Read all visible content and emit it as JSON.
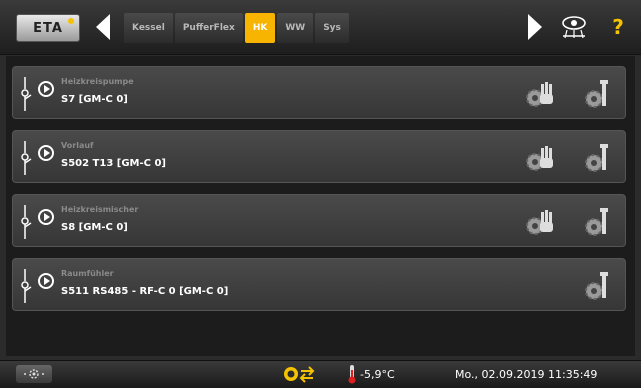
{
  "header": {
    "logo_text": "ETA",
    "tabs": [
      {
        "label": "Kessel",
        "active": false
      },
      {
        "label": "PufferFlex",
        "active": false
      },
      {
        "label": "HK",
        "active": true
      },
      {
        "label": "WW",
        "active": false
      },
      {
        "label": "Sys",
        "active": false
      }
    ],
    "help_label": "?",
    "accent_color": "#f7b400"
  },
  "rows": [
    {
      "title": "Heizkreispumpe",
      "subtitle": "S7 [GM-C 0]",
      "has_manual": true,
      "has_settings": true
    },
    {
      "title": "Vorlauf",
      "subtitle": "S502 T13 [GM-C 0]",
      "has_manual": true,
      "has_settings": true
    },
    {
      "title": "Heizkreismischer",
      "subtitle": "S8 [GM-C 0]",
      "has_manual": true,
      "has_settings": true
    },
    {
      "title": "Raumfühler",
      "subtitle": "S511 RS485 - RF-C 0 [GM-C 0]",
      "has_manual": false,
      "has_settings": true
    }
  ],
  "status_bar": {
    "outside_temperature": "-5,9°C",
    "datetime": "Mo., 02.09.2019 11:35:49"
  }
}
